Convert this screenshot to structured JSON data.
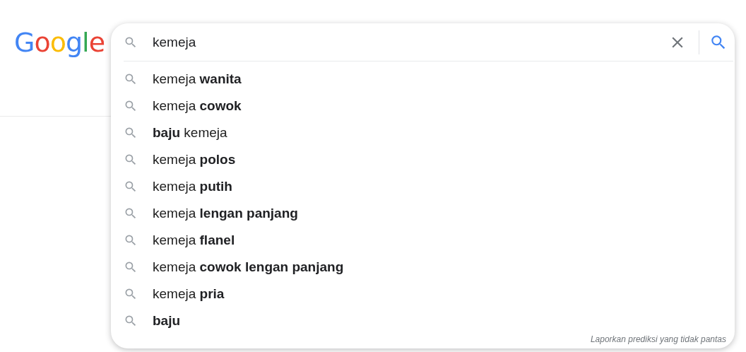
{
  "logo": "Google",
  "search": {
    "value": "kemeja"
  },
  "suggestions": [
    {
      "text": "kemeja **wanita**"
    },
    {
      "text": "kemeja **cowok**"
    },
    {
      "text": "**baju** kemeja"
    },
    {
      "text": "kemeja **polos**"
    },
    {
      "text": "kemeja **putih**"
    },
    {
      "text": "kemeja **lengan panjang**"
    },
    {
      "text": "kemeja **flanel**"
    },
    {
      "text": "kemeja **cowok lengan panjang**"
    },
    {
      "text": "kemeja **pria**"
    },
    {
      "text": "**baju**"
    }
  ],
  "report_link": "Laporkan prediksi yang tidak pantas"
}
